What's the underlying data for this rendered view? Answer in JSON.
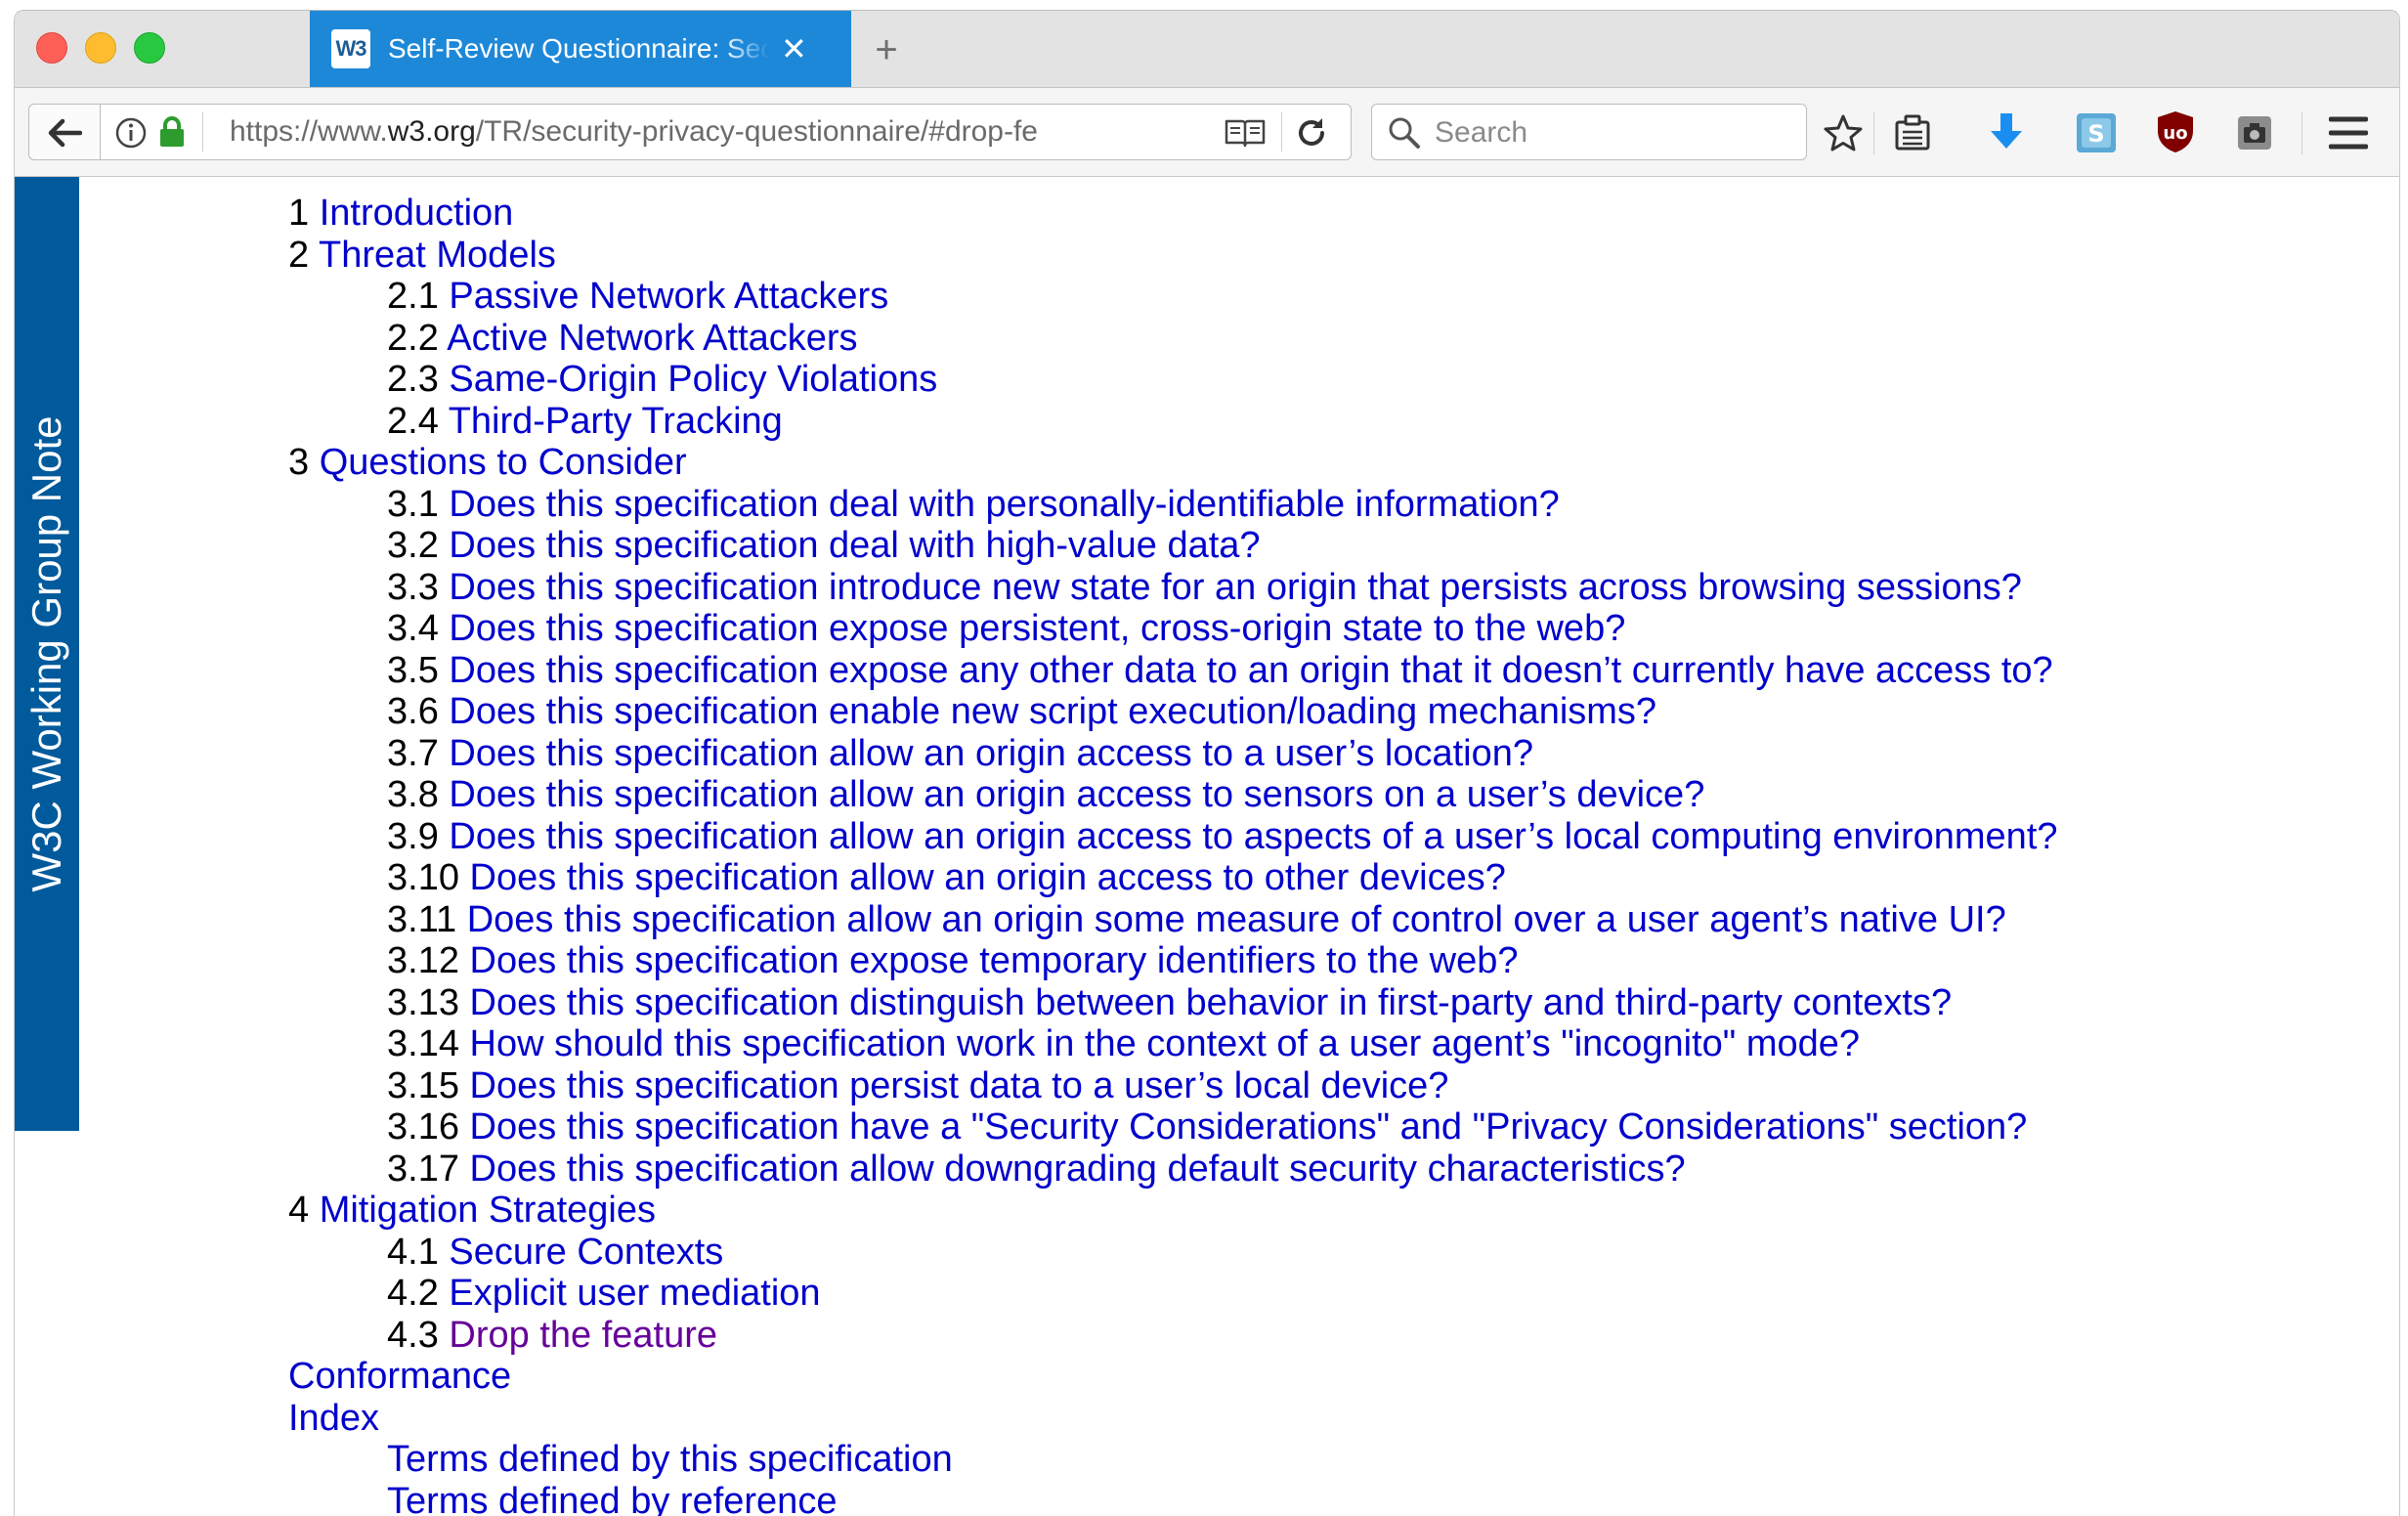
{
  "tabs": {
    "tab": {
      "favicon": "W3",
      "title": "Self-Review Questionnaire: Security and Privacy"
    },
    "close_glyph": "✕",
    "new_tab_glyph": "+"
  },
  "toolbar": {
    "url_host_prefix": "https://www.",
    "url_host": "w3.org",
    "url_path": "/TR/security-privacy-questionnaire/#drop-fe",
    "search_placeholder": "Search"
  },
  "colors": {
    "tab_active": "#1e88d8",
    "sidebar": "#005a9c",
    "link": "#0000cc",
    "visited_link": "#660099"
  },
  "sidebar": {
    "label": "W3C Working Group Note"
  },
  "toc": {
    "items": [
      {
        "level": 1,
        "num": "1",
        "text": "Introduction"
      },
      {
        "level": 1,
        "num": "2",
        "text": "Threat Models"
      },
      {
        "level": 2,
        "num": "2.1",
        "text": "Passive Network Attackers"
      },
      {
        "level": 2,
        "num": "2.2",
        "text": "Active Network Attackers"
      },
      {
        "level": 2,
        "num": "2.3",
        "text": "Same-Origin Policy Violations"
      },
      {
        "level": 2,
        "num": "2.4",
        "text": "Third-Party Tracking"
      },
      {
        "level": 1,
        "num": "3",
        "text": "Questions to Consider"
      },
      {
        "level": 2,
        "num": "3.1",
        "text": "Does this specification deal with personally-identifiable information?"
      },
      {
        "level": 2,
        "num": "3.2",
        "text": "Does this specification deal with high-value data?"
      },
      {
        "level": 2,
        "num": "3.3",
        "text": "Does this specification introduce new state for an origin that persists across browsing sessions?"
      },
      {
        "level": 2,
        "num": "3.4",
        "text": "Does this specification expose persistent, cross-origin state to the web?"
      },
      {
        "level": 2,
        "num": "3.5",
        "text": "Does this specification expose any other data to an origin that it doesn’t currently have access to?"
      },
      {
        "level": 2,
        "num": "3.6",
        "text": "Does this specification enable new script execution/loading mechanisms?"
      },
      {
        "level": 2,
        "num": "3.7",
        "text": "Does this specification allow an origin access to a user’s location?"
      },
      {
        "level": 2,
        "num": "3.8",
        "text": "Does this specification allow an origin access to sensors on a user’s device?"
      },
      {
        "level": 2,
        "num": "3.9",
        "text": "Does this specification allow an origin access to aspects of a user’s local computing environment?"
      },
      {
        "level": 2,
        "num": "3.10",
        "text": "Does this specification allow an origin access to other devices?"
      },
      {
        "level": 2,
        "num": "3.11",
        "text": "Does this specification allow an origin some measure of control over a user agent’s native UI?"
      },
      {
        "level": 2,
        "num": "3.12",
        "text": "Does this specification expose temporary identifiers to the web?"
      },
      {
        "level": 2,
        "num": "3.13",
        "text": "Does this specification distinguish between behavior in first-party and third-party contexts?"
      },
      {
        "level": 2,
        "num": "3.14",
        "text": "How should this specification work in the context of a user agent’s \"incognito\" mode?"
      },
      {
        "level": 2,
        "num": "3.15",
        "text": "Does this specification persist data to a user’s local device?"
      },
      {
        "level": 2,
        "num": "3.16",
        "text": "Does this specification have a \"Security Considerations\" and \"Privacy Considerations\" section?"
      },
      {
        "level": 2,
        "num": "3.17",
        "text": "Does this specification allow downgrading default security characteristics?"
      },
      {
        "level": 1,
        "num": "4",
        "text": "Mitigation Strategies"
      },
      {
        "level": 2,
        "num": "4.1",
        "text": "Secure Contexts"
      },
      {
        "level": 2,
        "num": "4.2",
        "text": "Explicit user mediation"
      },
      {
        "level": 2,
        "num": "4.3",
        "text": "Drop the feature",
        "visited": true
      },
      {
        "level": 1,
        "num": "",
        "text": "Conformance"
      },
      {
        "level": 1,
        "num": "",
        "text": "Index"
      },
      {
        "level": 2,
        "num": "",
        "text": "Terms defined by this specification"
      },
      {
        "level": 2,
        "num": "",
        "text": "Terms defined by reference"
      }
    ]
  }
}
